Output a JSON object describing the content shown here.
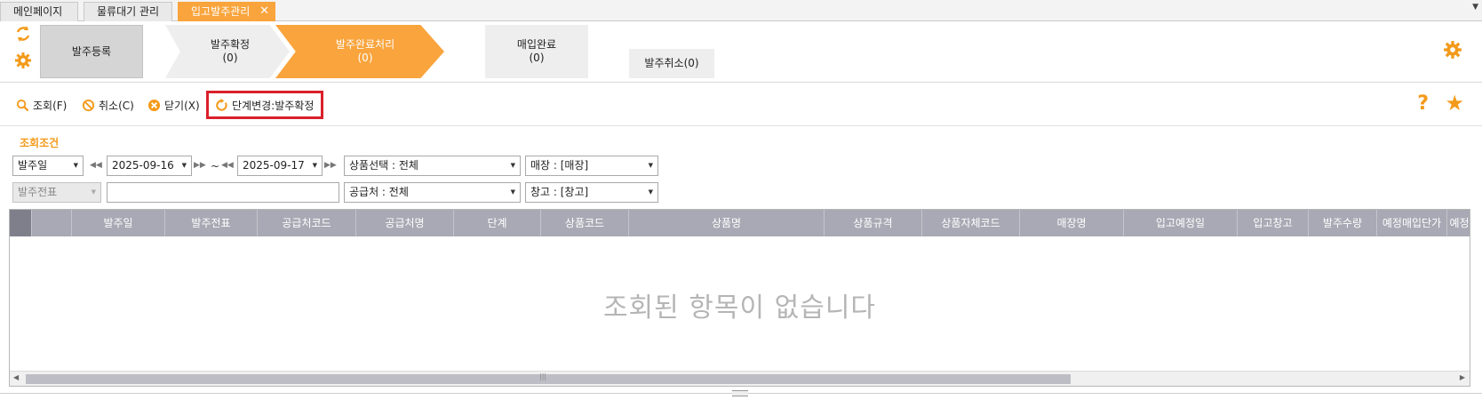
{
  "tabs": [
    {
      "label": "메인페이지"
    },
    {
      "label": "물류대기 관리"
    },
    {
      "label": "입고발주관리"
    }
  ],
  "workflow": {
    "register": {
      "label": "발주등록"
    },
    "confirm": {
      "label": "발주확정",
      "count": "(0)"
    },
    "complete": {
      "label": "발주완료처리",
      "count": "(0)"
    },
    "purchase": {
      "label": "매입완료",
      "count": "(0)"
    },
    "cancel": {
      "label": "발주취소(0)"
    }
  },
  "toolbar": {
    "search": "조회(F)",
    "cancel": "취소(C)",
    "close": "닫기(X)",
    "stage_change": "단계변경:발주확정"
  },
  "condition": {
    "title": "조회조건",
    "date_type": "발주일",
    "date_from": "2025-09-16",
    "date_to": "2025-09-17",
    "tilde": "~",
    "product_select": "상품선택 : 전체",
    "store": "매장 : [매장]",
    "slip_type": "발주전표",
    "slip_value": "",
    "supplier": "공급처 : 전체",
    "warehouse": "창고 : [창고]"
  },
  "grid": {
    "columns": [
      "발주일",
      "발주전표",
      "공급처코드",
      "공급처명",
      "단계",
      "상품코드",
      "상품명",
      "상품규격",
      "상품자체코드",
      "매장명",
      "입고예정일",
      "입고창고",
      "발주수량",
      "예정매입단가",
      "예정"
    ],
    "empty_message": "조회된 항목이 없습니다"
  },
  "colors": {
    "accent": "#f9a43c",
    "highlight_border": "#d9202a",
    "grid_header": "#a9a9b5"
  }
}
